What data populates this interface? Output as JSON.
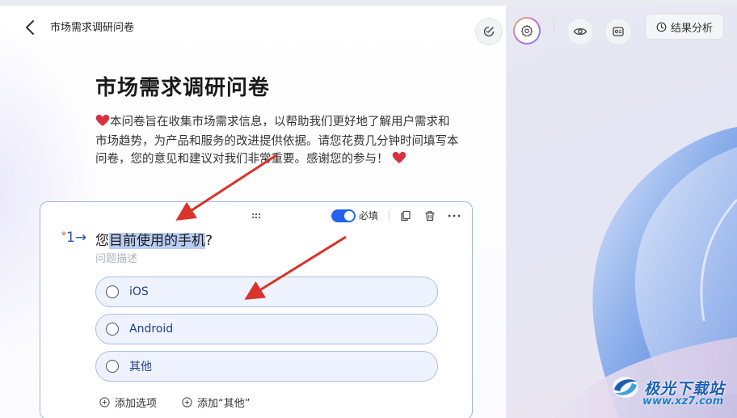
{
  "header": {
    "title": "市场需求调研问卷",
    "analysis_label": "结果分析"
  },
  "survey": {
    "title": "市场需求调研问卷",
    "intro": "本问卷旨在收集市场需求信息，以帮助我们更好地了解用户需求和市场趋势，为产品和服务的改进提供依据。请您花费几分钟时间填写本问卷，您的意见和建议对我们非常重要。感谢您的参与！"
  },
  "question": {
    "number": "1",
    "required_mark": "*",
    "title_before": "您",
    "title_selected": "目前使用的手机",
    "title_after": "?",
    "description_placeholder": "问题描述",
    "required_label": "必填",
    "required_on": true,
    "options": [
      {
        "label": "iOS"
      },
      {
        "label": "Android"
      },
      {
        "label": "其他"
      }
    ],
    "add_option_label": "添加选项",
    "add_other_label": "添加“其他”"
  },
  "watermark": {
    "main": "极光下载站",
    "sub": "www.xz7.com"
  },
  "colors": {
    "accent": "#2563eb",
    "arrow": "#d9332a",
    "option_bg": "#eef3ff",
    "card_border": "#9fb6e6"
  },
  "icons": [
    "back-arrow-icon",
    "edit-theme-icon",
    "settings-icon",
    "preview-eye-icon",
    "form-icon",
    "clock-icon",
    "drag-icon",
    "copy-icon",
    "delete-icon",
    "more-icon",
    "plus-circle-icon",
    "heart-icon"
  ]
}
